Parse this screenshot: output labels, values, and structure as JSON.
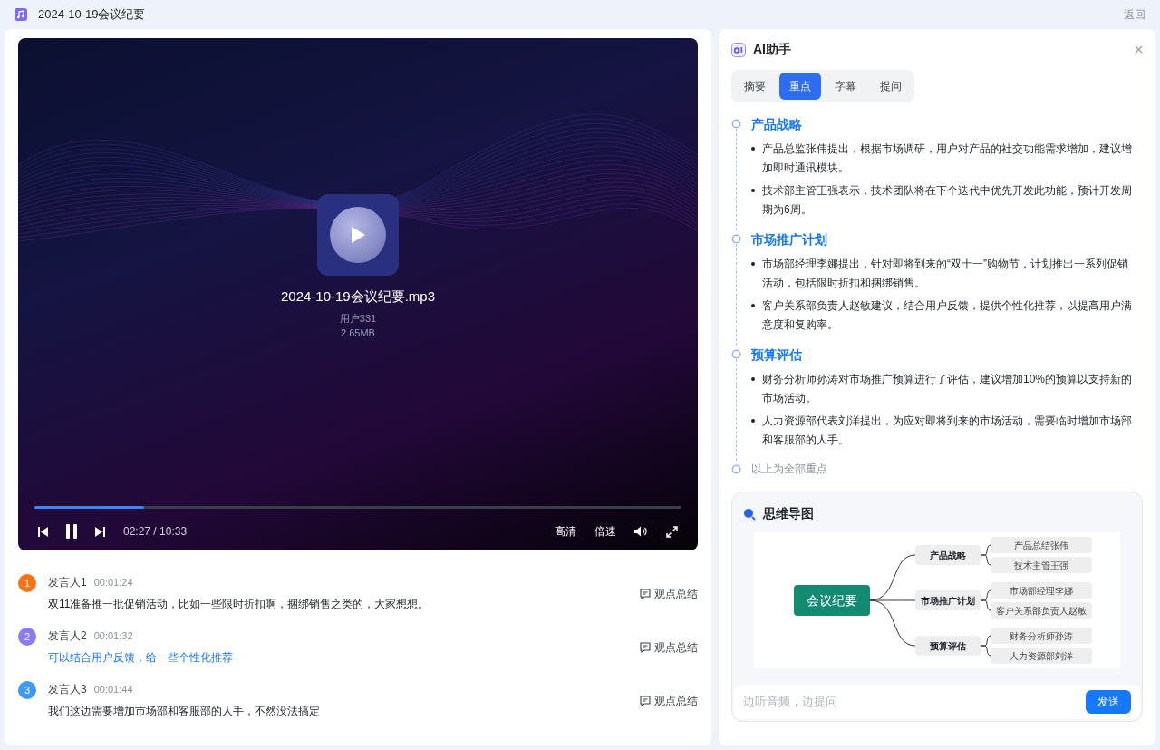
{
  "window": {
    "title": "2024-10-19会议纪要",
    "back": "返回"
  },
  "player": {
    "file_name": "2024-10-19会议纪要.mp3",
    "owner": "用户331",
    "size": "2.65MB",
    "playing": true,
    "level": 0.17,
    "time": "02:27 / 10:33",
    "quality": "高清",
    "speed": "倍速"
  },
  "transcript": [
    {
      "number": "1",
      "color": "#f97316",
      "speaker": "发言人1",
      "time": "00:01:24",
      "text": "双11准备推一批促销活动，比如一些限时折扣啊，捆绑销售之类的，大家想想。",
      "highlighted": false,
      "action": "观点总结"
    },
    {
      "number": "2",
      "color": "#8b7cf6",
      "speaker": "发言人2",
      "time": "00:01:32",
      "text": "可以结合用户反馈，给一些个性化推荐",
      "highlighted": true,
      "action": "观点总结"
    },
    {
      "number": "3",
      "color": "#3b9bf5",
      "speaker": "发言人3",
      "time": "00:01:44",
      "text": "我们这边需要增加市场部和客服部的人手，不然没法搞定",
      "highlighted": false,
      "action": "观点总结"
    }
  ],
  "assistant": {
    "title": "AI助手",
    "tabs": [
      {
        "label": "摘要",
        "selected": false
      },
      {
        "label": "重点",
        "selected": true
      },
      {
        "label": "字幕",
        "selected": false
      },
      {
        "label": "提问",
        "selected": false
      }
    ],
    "key_points": [
      {
        "heading": "产品战略",
        "bullets": [
          "产品总监张伟提出，根据市场调研，用户对产品的社交功能需求增加，建议增加即时通讯模块。",
          "技术部主管王强表示，技术团队将在下个迭代中优先开发此功能，预计开发周期为6周。"
        ]
      },
      {
        "heading": "市场推广计划",
        "bullets": [
          "市场部经理李娜提出，针对即将到来的“双十一”购物节，计划推出一系列促销活动，包括限时折扣和捆绑销售。",
          "客户关系部负责人赵敏建议，结合用户反馈，提供个性化推荐，以提高用户满意度和复购率。"
        ]
      },
      {
        "heading": "预算评估",
        "bullets": [
          "财务分析师孙涛对市场推广预算进行了评估，建议增加10%的预算以支持新的市场活动。",
          "人力资源部代表刘洋提出，为应对即将到来的市场活动，需要临时增加市场部和客服部的人手。"
        ]
      }
    ],
    "end_note": "以上为全部重点",
    "mind_map": {
      "title": "思维导图",
      "root": "会议纪要",
      "branches": [
        {
          "label": "产品战略",
          "children": [
            "产品总结张伟",
            "技术主管王强"
          ]
        },
        {
          "label": "市场推广计划",
          "children": [
            "市场部经理李娜",
            "客户关系部负责人赵敏"
          ]
        },
        {
          "label": "预算评估",
          "children": [
            "财务分析师孙涛",
            "人力资源部刘洋"
          ]
        }
      ]
    },
    "input": {
      "placeholder": "边听音频，边提问",
      "send": "发送"
    }
  }
}
